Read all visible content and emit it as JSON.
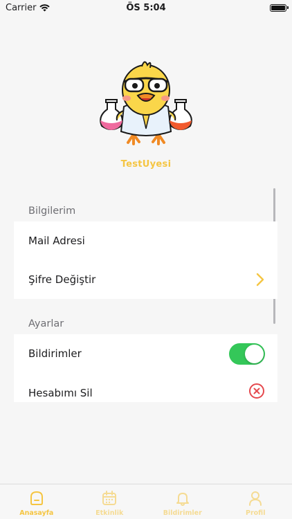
{
  "status_bar": {
    "carrier": "Carrier",
    "time": "ÖS 5:04"
  },
  "profile": {
    "username": "TestUyesi"
  },
  "sections": {
    "info": {
      "header": "Bilgilerim",
      "items": [
        {
          "label": "Mail Adresi"
        },
        {
          "label": "Şifre Değiştir",
          "accessory": "chevron-right-icon"
        }
      ]
    },
    "settings": {
      "header": "Ayarlar",
      "items": [
        {
          "label": "Bildirimler",
          "accessory": "toggle",
          "toggle_on": true
        },
        {
          "label": "Hesabımı Sil",
          "accessory": "close-circle-icon"
        }
      ]
    }
  },
  "tab_bar": {
    "tabs": [
      {
        "label": "Anasayfa",
        "icon": "home-icon"
      },
      {
        "label": "Etkinlik",
        "icon": "calendar-icon"
      },
      {
        "label": "Bildirimler",
        "icon": "bell-icon"
      },
      {
        "label": "Profil",
        "icon": "user-icon"
      }
    ]
  },
  "colors": {
    "accent": "#f5c542",
    "toggle_on": "#34c759",
    "destructive": "#e5484d",
    "background": "#f6f6f6"
  }
}
